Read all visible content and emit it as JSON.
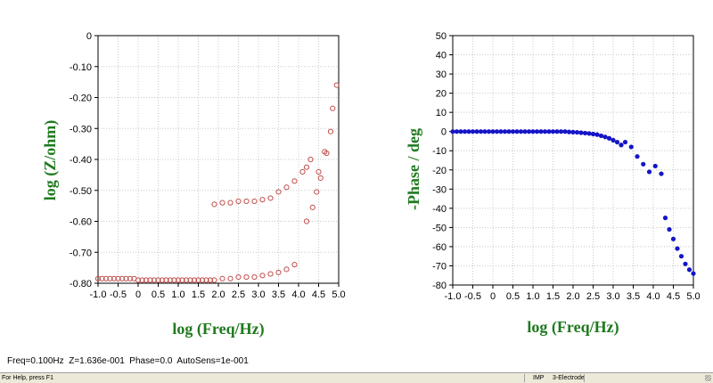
{
  "chart_data": [
    {
      "type": "scatter",
      "title": "",
      "xlabel": "log (Freq/Hz)",
      "ylabel": "log (Z/ohm)",
      "xlim": [
        -1.0,
        5.0
      ],
      "ylim": [
        -0.8,
        0.0
      ],
      "xticks": [
        "-1.0",
        "-0.5",
        "0",
        "0.5",
        "1.0",
        "1.5",
        "2.0",
        "2.5",
        "3.0",
        "3.5",
        "4.0",
        "4.5",
        "5.0"
      ],
      "yticks": [
        "0",
        "-0.10",
        "-0.20",
        "-0.30",
        "-0.40",
        "-0.50",
        "-0.60",
        "-0.70",
        "-0.80"
      ],
      "grid": true,
      "marker": "open-circle",
      "marker_color": "#c0504d",
      "series": [
        {
          "x": [
            -1.0,
            -0.9,
            -0.8,
            -0.7,
            -0.6,
            -0.5,
            -0.4,
            -0.3,
            -0.2,
            -0.1,
            0.0,
            0.1,
            0.2,
            0.3,
            0.4,
            0.5,
            0.6,
            0.7,
            0.8,
            0.9,
            1.0,
            1.1,
            1.2,
            1.3,
            1.4,
            1.5,
            1.6,
            1.7,
            1.8,
            1.9,
            2.1,
            2.3,
            2.5,
            2.7,
            2.9,
            3.1,
            3.3,
            3.5,
            3.7,
            3.9,
            4.2,
            4.35,
            4.5,
            4.65,
            4.8
          ],
          "y": [
            -0.785,
            -0.785,
            -0.785,
            -0.785,
            -0.785,
            -0.785,
            -0.785,
            -0.785,
            -0.785,
            -0.785,
            -0.79,
            -0.79,
            -0.79,
            -0.79,
            -0.79,
            -0.79,
            -0.79,
            -0.79,
            -0.79,
            -0.79,
            -0.79,
            -0.79,
            -0.79,
            -0.79,
            -0.79,
            -0.79,
            -0.79,
            -0.79,
            -0.79,
            -0.79,
            -0.785,
            -0.785,
            -0.78,
            -0.78,
            -0.78,
            -0.775,
            -0.77,
            -0.765,
            -0.755,
            -0.74,
            -0.6,
            -0.555,
            -0.44,
            -0.375,
            -0.31
          ]
        },
        {
          "x": [
            1.9,
            2.1,
            2.3,
            2.5,
            2.7,
            2.9,
            3.1,
            3.3,
            3.5,
            3.7,
            3.9,
            4.1,
            4.2,
            4.3,
            4.45,
            4.55,
            4.7,
            4.85,
            4.95
          ],
          "y": [
            -0.545,
            -0.54,
            -0.54,
            -0.535,
            -0.535,
            -0.535,
            -0.53,
            -0.525,
            -0.505,
            -0.49,
            -0.47,
            -0.44,
            -0.425,
            -0.4,
            -0.505,
            -0.46,
            -0.38,
            -0.235,
            -0.16
          ]
        }
      ]
    },
    {
      "type": "scatter",
      "title": "",
      "xlabel": "log (Freq/Hz)",
      "ylabel": "-Phase / deg",
      "xlim": [
        -1.0,
        5.0
      ],
      "ylim": [
        -80,
        50
      ],
      "xticks": [
        "-1.0",
        "-0.5",
        "0",
        "0.5",
        "1.0",
        "1.5",
        "2.0",
        "2.5",
        "3.0",
        "3.5",
        "4.0",
        "4.5",
        "5.0"
      ],
      "yticks": [
        "50",
        "40",
        "30",
        "20",
        "10",
        "0",
        "-10",
        "-20",
        "-30",
        "-40",
        "-50",
        "-60",
        "-70",
        "-80"
      ],
      "grid": true,
      "marker": "filled-circle",
      "marker_color": "#1414c8",
      "series": [
        {
          "x": [
            -1.0,
            -0.9,
            -0.8,
            -0.7,
            -0.6,
            -0.5,
            -0.4,
            -0.3,
            -0.2,
            -0.1,
            0.0,
            0.1,
            0.2,
            0.3,
            0.4,
            0.5,
            0.6,
            0.7,
            0.8,
            0.9,
            1.0,
            1.1,
            1.2,
            1.3,
            1.4,
            1.5,
            1.6,
            1.7,
            1.8,
            1.9,
            2.0,
            2.1,
            2.2,
            2.3,
            2.4,
            2.5,
            2.6,
            2.7,
            2.8,
            2.9,
            3.0,
            3.1,
            3.2,
            3.3,
            3.45,
            3.6,
            3.75,
            3.9,
            4.05,
            4.2,
            4.3,
            4.4,
            4.5,
            4.6,
            4.7,
            4.8,
            4.9,
            5.0
          ],
          "y": [
            0,
            0,
            0,
            0,
            0,
            0,
            0,
            0,
            0,
            0,
            0,
            0,
            0,
            0,
            0,
            0,
            0,
            0,
            0,
            0,
            0,
            0,
            0,
            0,
            0,
            0,
            0,
            0,
            0,
            -0.2,
            -0.3,
            -0.4,
            -0.6,
            -0.8,
            -1,
            -1.3,
            -1.6,
            -2.2,
            -2.8,
            -3.5,
            -4.5,
            -5.5,
            -7,
            -5.5,
            -8,
            -13,
            -17,
            -21,
            -18,
            -22,
            -45,
            -51,
            -56,
            -61,
            -65,
            -69,
            -72,
            -74
          ]
        }
      ]
    }
  ],
  "readout": "Freq=0.100Hz  Z=1.636e-001  Phase=0.0  AutoSens=1e-001",
  "statusbar": {
    "help": "For Help, press F1",
    "mode": "IMP",
    "electrode": "3-Electrode"
  }
}
